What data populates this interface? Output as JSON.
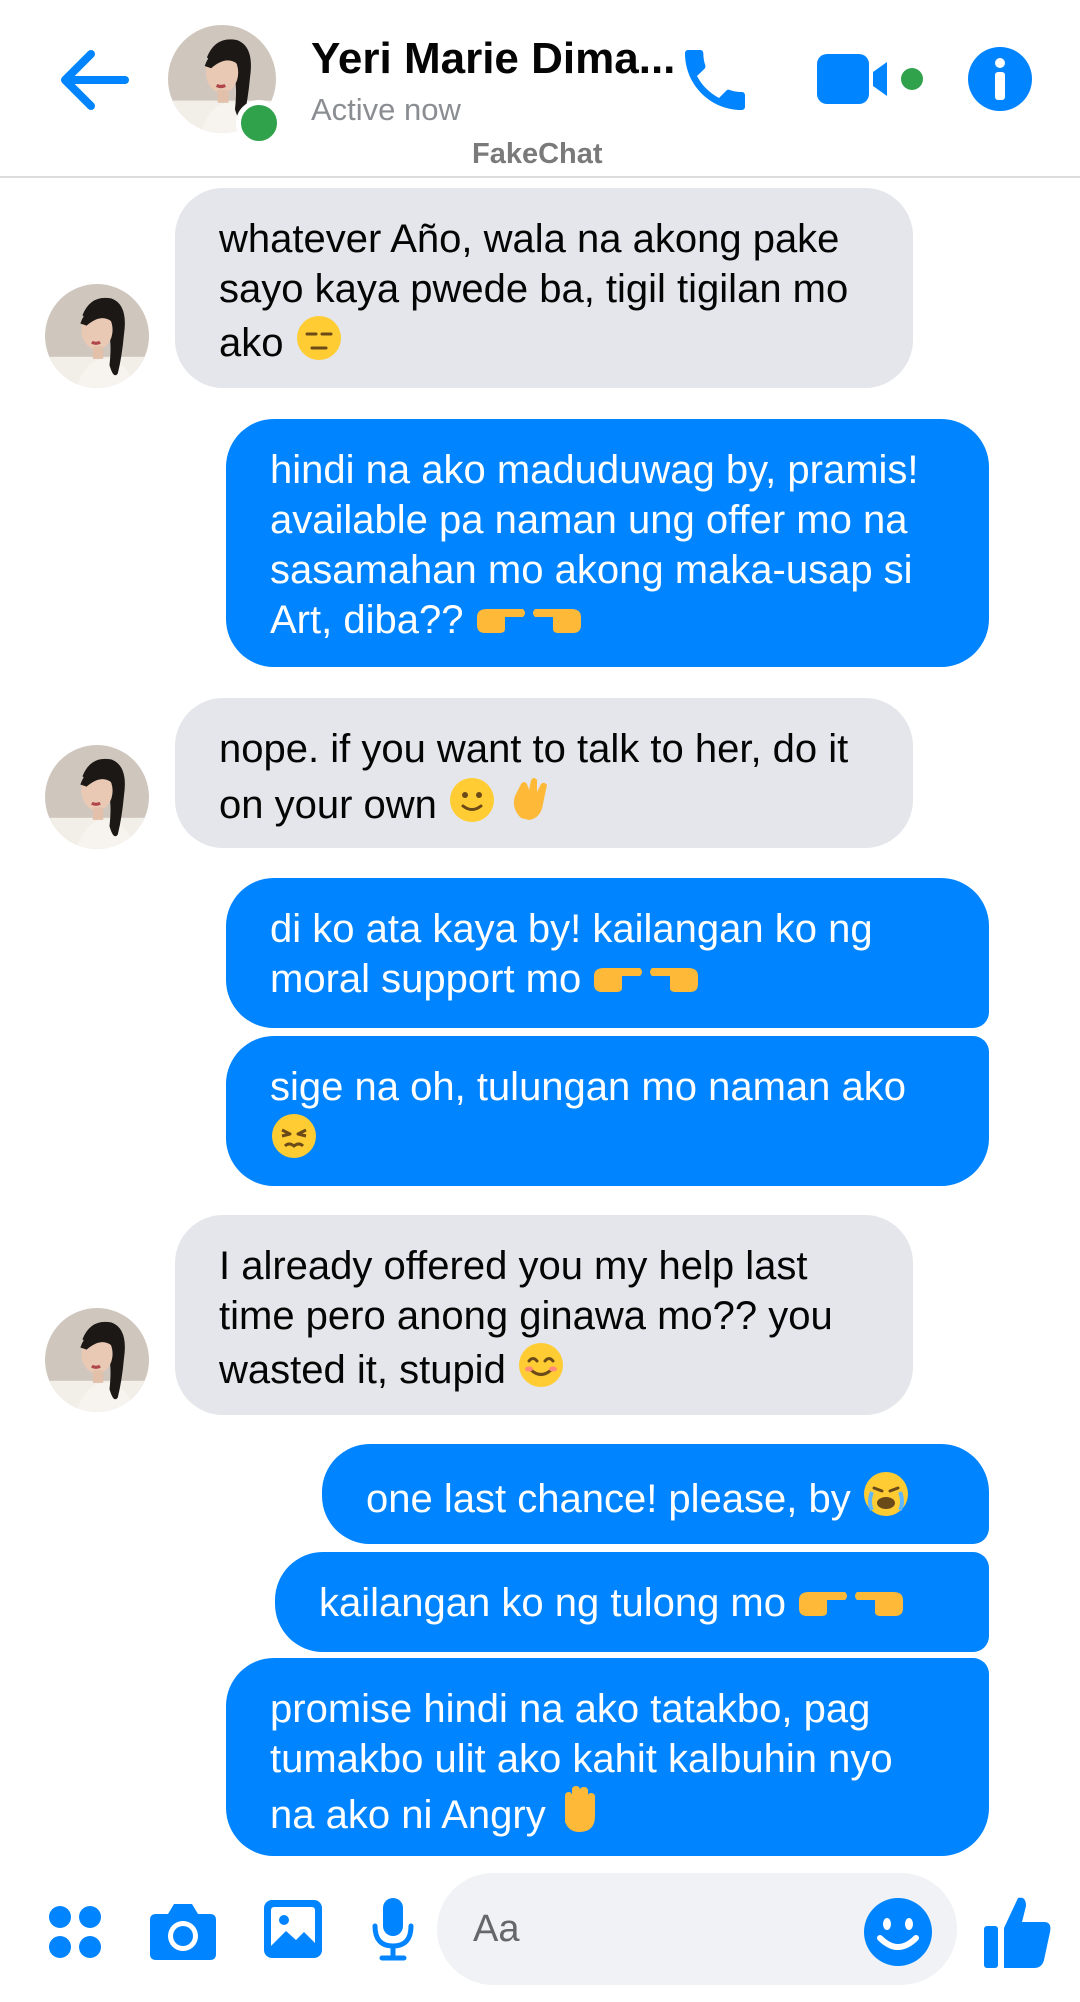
{
  "header": {
    "contact_name": "Yeri Marie Dima...",
    "status": "Active now",
    "watermark": "FakeChat"
  },
  "messages": [
    {
      "side": "incoming",
      "text": "whatever Año, wala na akong pake sayo kaya pwede ba, tigil tigilan mo ako",
      "emoji": "unamused-face"
    },
    {
      "side": "outgoing",
      "text": "hindi na ako maduduwag by, pramis! available pa naman ung offer mo na sasamahan mo akong maka-usap si Art, diba??",
      "emoji": "pointing-fingers"
    },
    {
      "side": "incoming",
      "text": "nope. if you want to talk to her, do it on your own",
      "emoji": "slight-smile-waving-hand"
    },
    {
      "side": "outgoing",
      "text": "di ko ata kaya by! kailangan ko ng moral support mo",
      "emoji": "pointing-fingers"
    },
    {
      "side": "outgoing",
      "text": "sige na oh, tulungan mo naman ako",
      "emoji": "persevering-face"
    },
    {
      "side": "incoming",
      "text": "I already offered you my help last time pero anong ginawa mo?? you wasted it, stupid",
      "emoji": "smiling-face"
    },
    {
      "side": "outgoing",
      "text": "one last chance! please, by",
      "emoji": "crying-face"
    },
    {
      "side": "outgoing",
      "text": "kailangan ko ng tulong mo",
      "emoji": "pointing-fingers"
    },
    {
      "side": "outgoing",
      "text": "promise hindi na ako tatakbo, pag tumakbo ulit ako kahit kalbuhin nyo na ako ni Angry",
      "emoji": "raised-hand"
    }
  ],
  "composer": {
    "placeholder": "Aa"
  },
  "colors": {
    "accent": "#0084ff",
    "outgoing_bubble": "#0084ff",
    "incoming_bubble": "#e4e6eb",
    "online": "#31a24c"
  },
  "icons": [
    "back-arrow-icon",
    "phone-icon",
    "video-camera-icon",
    "info-icon",
    "apps-icon",
    "camera-icon",
    "image-icon",
    "microphone-icon",
    "emoji-icon",
    "thumbs-up-icon"
  ]
}
